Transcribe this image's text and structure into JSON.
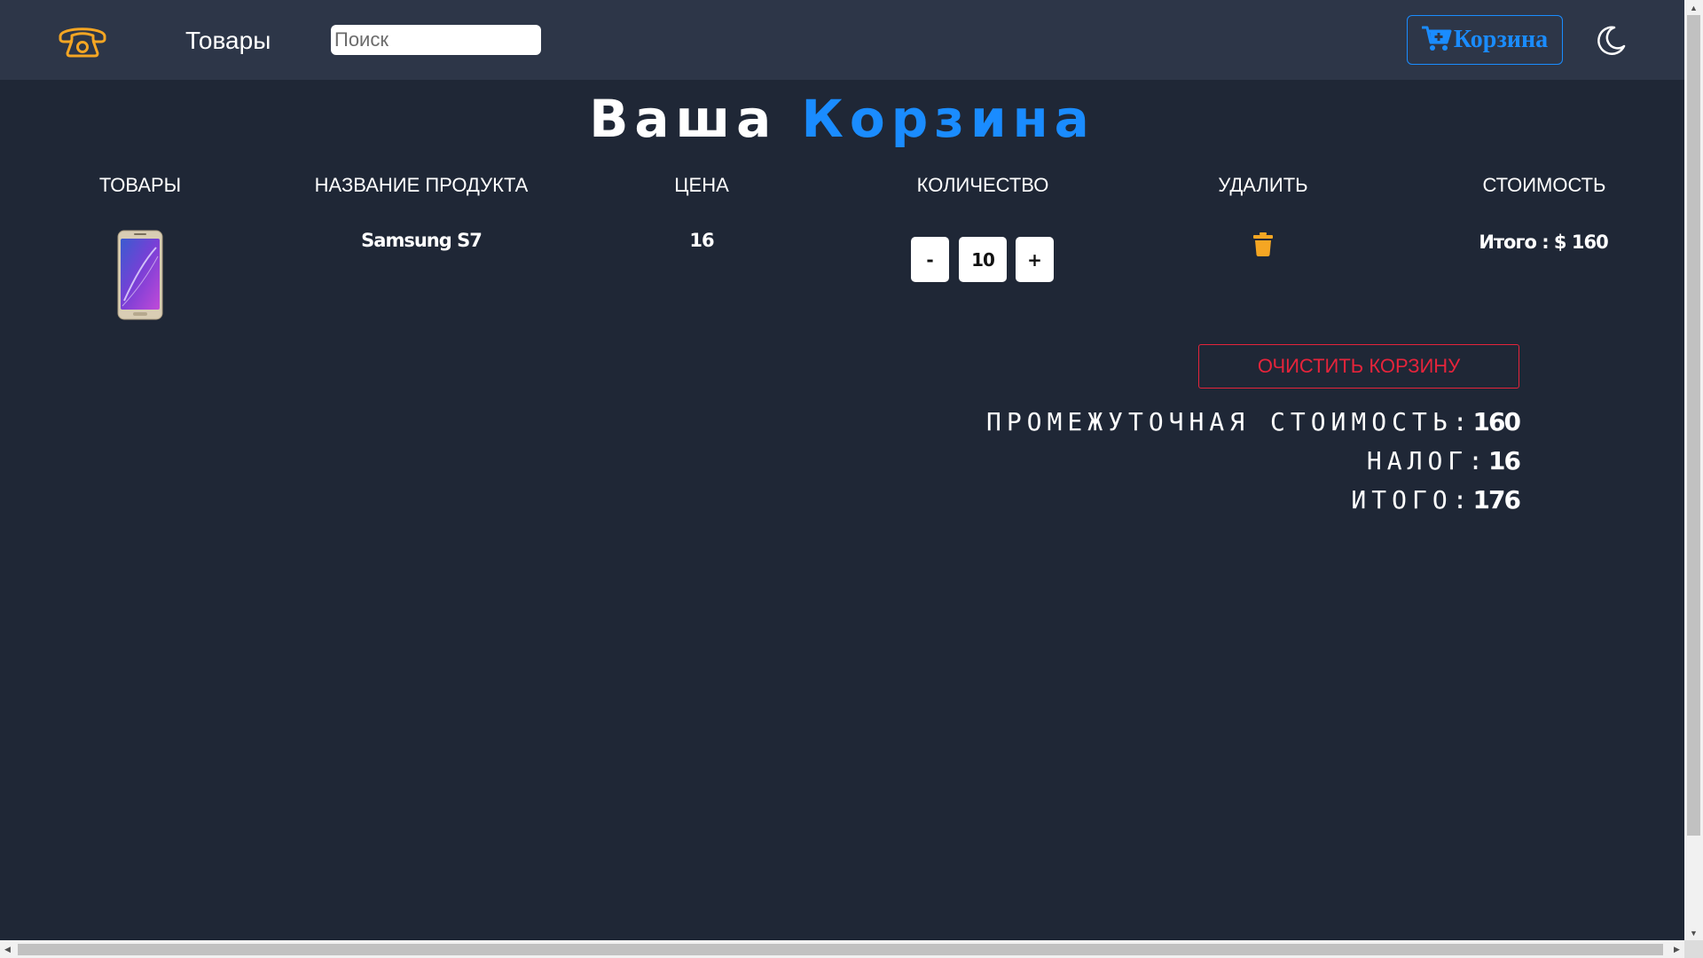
{
  "navbar": {
    "phone_icon": "phone-icon",
    "products_link": "Товары",
    "search_placeholder": "Поиск",
    "search_value": "",
    "cart_label": "Корзина",
    "cart_icon": "cart-plus-icon",
    "theme_icon": "moon-icon"
  },
  "title": {
    "part1": "Ваша",
    "part2": "Корзина"
  },
  "table": {
    "headers": [
      "ТОВАРЫ",
      "НАЗВАНИЕ ПРОДУКТА",
      "ЦЕНА",
      "КОЛИЧЕСТВО",
      "УДАЛИТЬ",
      "СТОИМОСТЬ"
    ],
    "rows": [
      {
        "image_icon": "smartphone-image",
        "name": "Samsung S7",
        "price": "16",
        "decrement": "-",
        "quantity": "10",
        "increment": "+",
        "delete_icon": "trash-icon",
        "total_label": "Итого :",
        "total_value": "$ 160"
      }
    ]
  },
  "clear_button": "ОЧИСТИТЬ КОРЗИНУ",
  "summary": {
    "subtotal_label": "ПРОМЕЖУТОЧНАЯ СТОИМОСТЬ:",
    "subtotal_value": "160",
    "tax_label": "НАЛОГ:",
    "tax_value": "16",
    "total_label": "ИТОГО:",
    "total_value": "176"
  },
  "colors": {
    "background": "#1f2736",
    "navbar": "#2d3648",
    "accent_blue": "#1a8cff",
    "accent_orange": "#f5a623",
    "danger_red": "#e5243b"
  }
}
